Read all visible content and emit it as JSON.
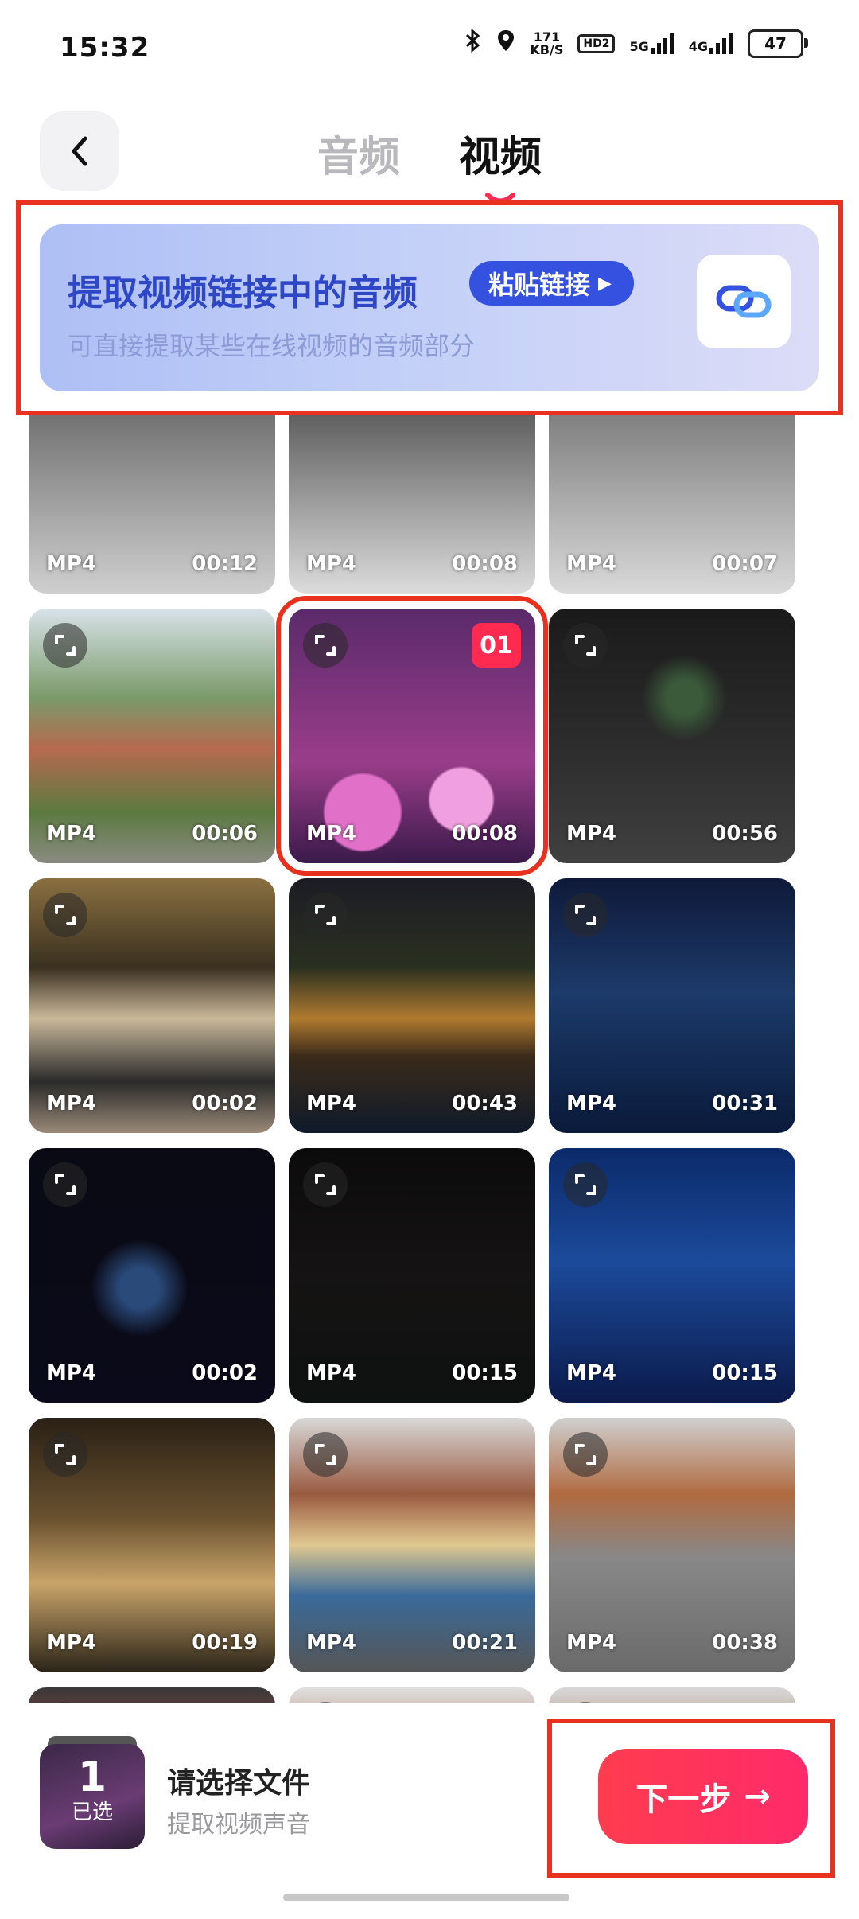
{
  "status": {
    "time": "15:32",
    "net_speed_value": "171",
    "net_speed_unit": "KB/S",
    "hd_badge": "HD2",
    "sig1": "5G",
    "sig2": "4G",
    "battery": "47"
  },
  "header": {
    "tabs": [
      {
        "label": "音频",
        "active": false
      },
      {
        "label": "视频",
        "active": true
      }
    ]
  },
  "banner": {
    "title": "提取视频链接中的音频",
    "paste_label": "粘贴链接",
    "subtitle": "可直接提取某些在线视频的音频部分"
  },
  "partial_row": [
    {
      "format": "MP4",
      "duration": "00:12"
    },
    {
      "format": "MP4",
      "duration": "00:08"
    },
    {
      "format": "MP4",
      "duration": "00:07"
    }
  ],
  "videos": [
    {
      "format": "MP4",
      "duration": "00:06"
    },
    {
      "format": "MP4",
      "duration": "00:08",
      "badge": "01",
      "selected": true
    },
    {
      "format": "MP4",
      "duration": "00:56"
    },
    {
      "format": "MP4",
      "duration": "00:02"
    },
    {
      "format": "MP4",
      "duration": "00:43"
    },
    {
      "format": "MP4",
      "duration": "00:31"
    },
    {
      "format": "MP4",
      "duration": "00:02"
    },
    {
      "format": "MP4",
      "duration": "00:15"
    },
    {
      "format": "MP4",
      "duration": "00:15"
    },
    {
      "format": "MP4",
      "duration": "00:19"
    },
    {
      "format": "MP4",
      "duration": "00:21"
    },
    {
      "format": "MP4",
      "duration": "00:38"
    },
    {
      "format": "",
      "duration": ""
    },
    {
      "format": "",
      "duration": ""
    },
    {
      "format": "",
      "duration": ""
    }
  ],
  "bottom": {
    "count": "1",
    "count_label": "已选",
    "title": "请选择文件",
    "subtitle": "提取视频声音",
    "next_label": "下一步",
    "next_arrow": "→"
  }
}
